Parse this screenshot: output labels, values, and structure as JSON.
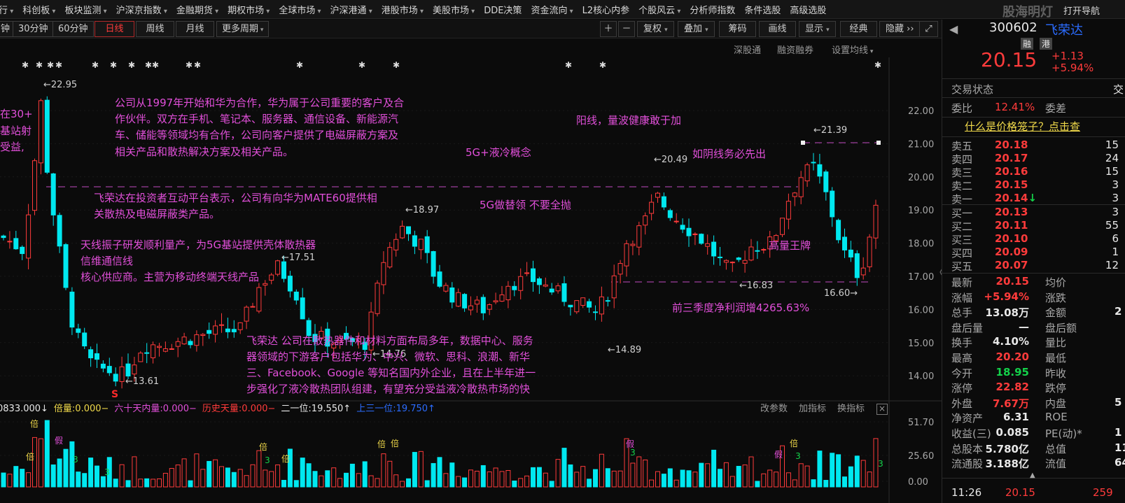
{
  "menubar": {
    "items": [
      {
        "label": "行",
        "dd": true
      },
      {
        "label": "科创板",
        "dd": true
      },
      {
        "label": "板块监测",
        "dd": true
      },
      {
        "label": "沪深京指数",
        "dd": true
      },
      {
        "label": "金融期货",
        "dd": true
      },
      {
        "label": "期权市场",
        "dd": true
      },
      {
        "label": "全球市场",
        "dd": true
      },
      {
        "label": "沪深港通",
        "dd": true
      },
      {
        "label": "港股市场",
        "dd": true
      },
      {
        "label": "美股市场",
        "dd": true
      },
      {
        "label": "DDE决策",
        "dd": false
      },
      {
        "label": "资金流向",
        "dd": true
      },
      {
        "label": "L2核心内参",
        "dd": false
      },
      {
        "label": "个股风云",
        "dd": true
      },
      {
        "label": "分析师指数",
        "dd": false
      },
      {
        "label": "条件选股",
        "dd": false
      },
      {
        "label": "高级选股",
        "dd": false
      }
    ],
    "watermark": "股海明灯",
    "right_link": "打开导航"
  },
  "period": {
    "items": [
      "钟",
      "30分钟",
      "60分钟",
      "日线",
      "周线",
      "月线"
    ],
    "active": "日线",
    "more": "更多周期"
  },
  "tools": {
    "items": [
      "复权",
      "叠加",
      "筹码",
      "画线",
      "显示",
      "经典",
      "隐藏"
    ]
  },
  "subbar": {
    "items": [
      "深股通",
      "融资融券",
      "设置均线"
    ]
  },
  "chart": {
    "price_axis": [
      "22.00",
      "21.00",
      "20.00",
      "19.00",
      "18.00",
      "17.00",
      "16.00",
      "15.00",
      "14.00"
    ],
    "vol_axis": [
      "51.70",
      "25.60",
      "0.00"
    ],
    "price_marks": [
      "22.95",
      "21.39",
      "20.49",
      "18.97",
      "17.51",
      "16.83",
      "16.60",
      "14.89",
      "14.76",
      "13.61"
    ],
    "s_signal": "S",
    "annotations": [
      "在30+",
      "基站射",
      "受益,",
      "公司从1997年开始和华为合作，华为属于公司重要的客户及合",
      "作伙伴。双方在手机、笔记本、服务器、通信设备、新能源汽",
      "车、储能等领域均有合作，公司向客户提供了电磁屏蔽方案及",
      "相关产品和散热解决方案及相关产品。",
      "飞荣达在投资者互动平台表示，公司有向华为MATE60提供相",
      "关散热及电磁屏蔽类产品。",
      "天线振子研发顺利量产，为5G基站提供壳体散热器",
      "信维通信线",
      "核心供应商。主营为移动终端天线产品",
      "阳线，量波健康敢于加",
      "5G+液冷概念",
      "如阴线务必先出",
      "5G做替领 不要全抛",
      "高量王牌",
      "前三季度净利润增4265.63%",
      "飞荣达 公司在散热器件和材料方面布局多年，数据中心、服务",
      "器领域的下游客户包括华为、中兴、微软、思科、浪潮、新华",
      "三、Facebook、Google 等知名国内外企业，且在上半年进一",
      "步强化了液冷散热团队组建，有望充分受益液冷散热市场的快"
    ]
  },
  "vol_bar": {
    "items": [
      {
        "label": "0833.000↓",
        "color": "#e8e8e8"
      },
      {
        "label": "倍量:0.000−",
        "color": "#f0d94a"
      },
      {
        "label": "六十天内量:0.000−",
        "color": "#e14fd9"
      },
      {
        "label": "历史天量:0.000−",
        "color": "#ff3b3b"
      },
      {
        "label": "二一位:19.550↑",
        "color": "#e8e8e8"
      },
      {
        "label": "上三一位:19.750↑",
        "color": "#2b6cff"
      }
    ],
    "buttons": [
      "改参数",
      "加指标",
      "换指标"
    ]
  },
  "stock": {
    "code": "300602",
    "name": "飞荣达",
    "tags": [
      "融",
      "港"
    ],
    "price": "20.15",
    "change": "+1.13",
    "pct": "+5.94%",
    "trade_status_label": "交易状态",
    "trade_status_value": "交",
    "webi_label": "委比",
    "webi": "12.41%",
    "wecha_label": "委差",
    "promo": "什么是价格笼子？点击查",
    "orderbook": [
      {
        "label": "卖五",
        "price": "20.18",
        "vol": "15"
      },
      {
        "label": "卖四",
        "price": "20.17",
        "vol": "24"
      },
      {
        "label": "卖三",
        "price": "20.16",
        "vol": "15"
      },
      {
        "label": "卖二",
        "price": "20.15",
        "vol": "3"
      },
      {
        "label": "卖一",
        "price": "20.14↓",
        "vol": "3"
      },
      {
        "label": "买一",
        "price": "20.13",
        "vol": "3"
      },
      {
        "label": "买二",
        "price": "20.11",
        "vol": "55"
      },
      {
        "label": "买三",
        "price": "20.10",
        "vol": "6"
      },
      {
        "label": "买四",
        "price": "20.09",
        "vol": "1"
      },
      {
        "label": "买五",
        "price": "20.07",
        "vol": "12"
      }
    ],
    "stats": [
      {
        "k1": "最新",
        "v1": "20.15",
        "c1": "red",
        "k2": "均价",
        "v2": ""
      },
      {
        "k1": "涨幅",
        "v1": "+5.94%",
        "c1": "red",
        "k2": "涨跌",
        "v2": ""
      },
      {
        "k1": "总手",
        "v1": "13.08万",
        "c1": "white",
        "k2": "金额",
        "v2": "2"
      },
      {
        "k1": "盘后量",
        "v1": "—",
        "c1": "white",
        "k2": "盘后额",
        "v2": ""
      },
      {
        "k1": "换手",
        "v1": "4.10%",
        "c1": "white",
        "k2": "量比",
        "v2": ""
      },
      {
        "k1": "最高",
        "v1": "20.20",
        "c1": "red",
        "k2": "最低",
        "v2": ""
      },
      {
        "k1": "今开",
        "v1": "18.95",
        "c1": "green",
        "k2": "昨收",
        "v2": ""
      },
      {
        "k1": "涨停",
        "v1": "22.82",
        "c1": "red",
        "k2": "跌停",
        "v2": ""
      },
      {
        "k1": "外盘",
        "v1": "7.67万",
        "c1": "red",
        "k2": "内盘",
        "v2": "5"
      },
      {
        "k1": "净资产",
        "v1": "6.31",
        "c1": "white",
        "k2": "ROE",
        "v2": ""
      },
      {
        "k1": "收益(三)",
        "v1": "0.085",
        "c1": "white",
        "k2": "PE(动)*",
        "v2": "1"
      },
      {
        "k1": "总股本",
        "v1": "5.780亿",
        "c1": "white",
        "k2": "总值",
        "v2": "11"
      },
      {
        "k1": "流通股",
        "v1": "3.188亿",
        "c1": "white",
        "k2": "流值",
        "v2": "64"
      }
    ],
    "last_time": "11:26",
    "last_price": "20.15",
    "last_vol": "259"
  }
}
